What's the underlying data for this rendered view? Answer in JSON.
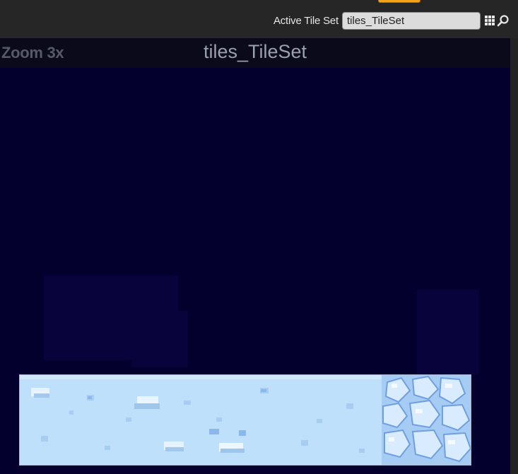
{
  "toolbar": {
    "active_tile_set_label": "Active Tile Set",
    "active_tile_set_value": "tiles_TileSet"
  },
  "viewport": {
    "zoom_label": "Zoom 3x",
    "title": "tiles_TileSet"
  },
  "icons": {
    "grid": "grid-icon",
    "search": "search-icon"
  },
  "colors": {
    "viewport_background": "#04002e",
    "panel_background": "#262626",
    "accent_tab": "#f2a21b",
    "tile_sky": "#bfe0fb"
  }
}
